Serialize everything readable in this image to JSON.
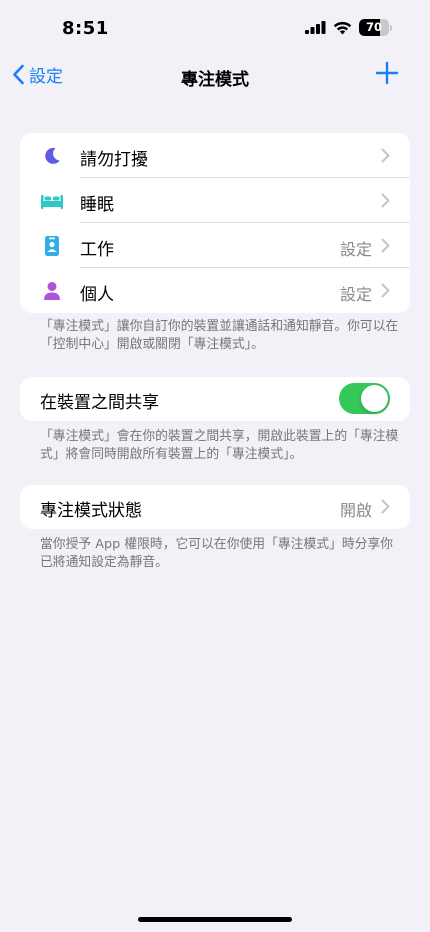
{
  "status_bar": {
    "time": "8:51",
    "battery_level": "70"
  },
  "nav": {
    "back_label": "設定",
    "title": "專注模式",
    "accent_color": "#1a7ef6"
  },
  "focus_modes": [
    {
      "label": "請勿打擾",
      "detail": "",
      "icon": "moon-icon",
      "color": "#5e5ce6"
    },
    {
      "label": "睡眠",
      "detail": "",
      "icon": "bed-icon",
      "color": "#2fc7c8"
    },
    {
      "label": "工作",
      "detail": "設定",
      "icon": "id-badge-icon",
      "color": "#32ade6"
    },
    {
      "label": "個人",
      "detail": "設定",
      "icon": "person-icon",
      "color": "#af52de"
    }
  ],
  "focus_modes_footer": "「專注模式」讓你自訂你的裝置並讓通話和通知靜音。你可以在「控制中心」開啟或關閉「專注模式」。",
  "share": {
    "label": "在裝置之間共享",
    "enabled": true,
    "footer": "「專注模式」會在你的裝置之間共享，開啟此裝置上的「專注模式」將會同時開啟所有裝置上的「專注模式」。"
  },
  "focus_status": {
    "label": "專注模式狀態",
    "detail": "開啟",
    "footer": "當你授予 App 權限時，它可以在你使用「專注模式」時分享你已將通知設定為靜音。"
  }
}
